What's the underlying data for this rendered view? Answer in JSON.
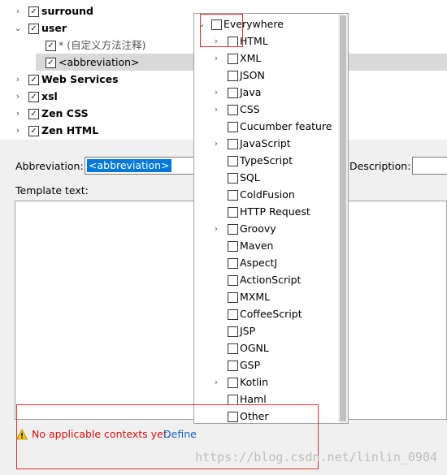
{
  "tree": {
    "items": [
      {
        "label": "surround",
        "bold": true,
        "checked": true,
        "expanded": false
      },
      {
        "label": "user",
        "bold": true,
        "checked": true,
        "expanded": true
      },
      {
        "label": "* (自定义方法注释)",
        "bold": false,
        "checked": true,
        "child": true
      },
      {
        "label": "<abbreviation>",
        "bold": false,
        "checked": true,
        "child": true,
        "selected": true
      },
      {
        "label": "Web Services",
        "bold": true,
        "checked": true,
        "expanded": false
      },
      {
        "label": "xsl",
        "bold": true,
        "checked": true,
        "expanded": false
      },
      {
        "label": "Zen CSS",
        "bold": true,
        "checked": true,
        "expanded": false
      },
      {
        "label": "Zen HTML",
        "bold": true,
        "checked": true,
        "expanded": false
      }
    ]
  },
  "abbreviation": {
    "label": "Abbreviation:",
    "value": "<abbreviation>"
  },
  "description": {
    "label": "Description:"
  },
  "template_text": {
    "label": "Template text:"
  },
  "contexts": {
    "root": "Everywhere",
    "items": [
      {
        "label": "HTML",
        "expandable": true
      },
      {
        "label": "XML",
        "expandable": true
      },
      {
        "label": "JSON",
        "expandable": false
      },
      {
        "label": "Java",
        "expandable": true
      },
      {
        "label": "CSS",
        "expandable": true
      },
      {
        "label": "Cucumber feature",
        "expandable": false
      },
      {
        "label": "JavaScript",
        "expandable": true
      },
      {
        "label": "TypeScript",
        "expandable": false
      },
      {
        "label": "SQL",
        "expandable": false
      },
      {
        "label": "ColdFusion",
        "expandable": false
      },
      {
        "label": "HTTP Request",
        "expandable": false
      },
      {
        "label": "Groovy",
        "expandable": true
      },
      {
        "label": "Maven",
        "expandable": false
      },
      {
        "label": "AspectJ",
        "expandable": false
      },
      {
        "label": "ActionScript",
        "expandable": false
      },
      {
        "label": "MXML",
        "expandable": false
      },
      {
        "label": "CoffeeScript",
        "expandable": false
      },
      {
        "label": "JSP",
        "expandable": false
      },
      {
        "label": "OGNL",
        "expandable": false
      },
      {
        "label": "GSP",
        "expandable": false
      },
      {
        "label": "Kotlin",
        "expandable": true
      },
      {
        "label": "Haml",
        "expandable": false
      },
      {
        "label": "Other",
        "expandable": false
      }
    ]
  },
  "warning": {
    "text": "No applicable contexts yet.",
    "link": "Define"
  },
  "watermark": "https://blog.csdn.net/linlin_0904",
  "colors": {
    "warning_text": "#d11",
    "link": "#1a5fc4",
    "selection": "#0078d7",
    "annotation_box": "#e03030"
  }
}
